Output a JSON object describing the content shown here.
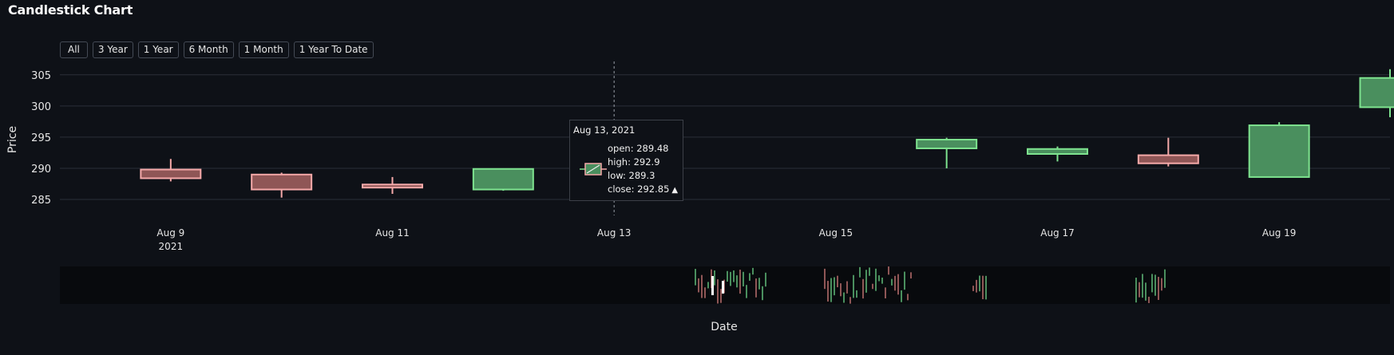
{
  "title": "Candlestick Chart",
  "range_buttons": [
    "All",
    "3 Year",
    "1 Year",
    "6 Month",
    "1 Month",
    "1 Year To Date"
  ],
  "colors": {
    "background": "#0e1117",
    "grid": "#2b2f38",
    "text": "#e6e6e6",
    "increasing_line": "#7ee38f",
    "increasing_fill": "#4a8f5e",
    "decreasing_line": "#f5a9a9",
    "decreasing_fill": "#8f5656",
    "navigator_bg": "#080a0d"
  },
  "tooltip": {
    "date": "Aug 13, 2021",
    "open": "open: 289.48",
    "high": "high: 292.9",
    "low": "low: 289.3",
    "close": "close: 292.85",
    "direction_icon": "triangle-up-icon",
    "direction_glyph": "▲"
  },
  "chart_data": {
    "type": "candlestick",
    "xlabel": "Date",
    "ylabel": "Price",
    "ylim": [
      282.7,
      308.3
    ],
    "yticks": [
      285,
      290,
      295,
      300,
      305
    ],
    "xlim": [
      "2021-08-08",
      "2021-08-20"
    ],
    "xticks": [
      {
        "date": "2021-08-09",
        "label": "Aug 9",
        "sublabel": "2021"
      },
      {
        "date": "2021-08-11",
        "label": "Aug 11",
        "sublabel": ""
      },
      {
        "date": "2021-08-13",
        "label": "Aug 13",
        "sublabel": ""
      },
      {
        "date": "2021-08-15",
        "label": "Aug 15",
        "sublabel": ""
      },
      {
        "date": "2021-08-17",
        "label": "Aug 17",
        "sublabel": ""
      },
      {
        "date": "2021-08-19",
        "label": "Aug 19",
        "sublabel": ""
      }
    ],
    "hover_date": "2021-08-13",
    "candles": [
      {
        "date": "2021-08-09",
        "open": 289.8,
        "high": 291.5,
        "low": 287.9,
        "close": 288.4
      },
      {
        "date": "2021-08-10",
        "open": 289.0,
        "high": 289.3,
        "low": 285.3,
        "close": 286.6
      },
      {
        "date": "2021-08-11",
        "open": 287.4,
        "high": 288.6,
        "low": 285.9,
        "close": 286.9
      },
      {
        "date": "2021-08-12",
        "open": 286.6,
        "high": 290.0,
        "low": 286.4,
        "close": 289.9
      },
      {
        "date": "2021-08-13",
        "open": 289.48,
        "high": 292.9,
        "low": 289.3,
        "close": 292.85
      },
      {
        "date": "2021-08-16",
        "open": 293.2,
        "high": 294.9,
        "low": 290.0,
        "close": 294.6
      },
      {
        "date": "2021-08-17",
        "open": 292.3,
        "high": 293.5,
        "low": 291.1,
        "close": 293.1
      },
      {
        "date": "2021-08-18",
        "open": 292.1,
        "high": 294.9,
        "low": 290.3,
        "close": 290.8
      },
      {
        "date": "2021-08-19",
        "open": 288.6,
        "high": 297.4,
        "low": 288.6,
        "close": 296.9
      },
      {
        "date": "2021-08-20",
        "open": 299.8,
        "high": 305.9,
        "low": 298.2,
        "close": 304.5
      }
    ]
  }
}
